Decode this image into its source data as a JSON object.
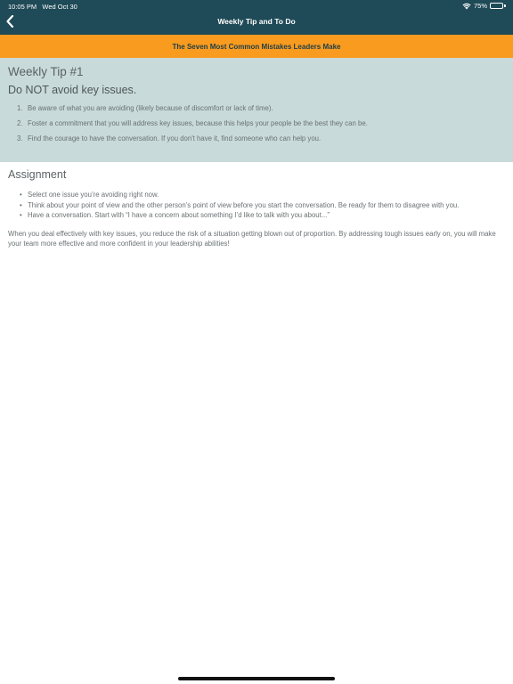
{
  "status_bar": {
    "time": "10:05 PM",
    "date": "Wed Oct 30",
    "battery": "75%",
    "battery_level": 0.75,
    "wifi_icon": "wifi-icon",
    "battery_icon": "battery-icon"
  },
  "nav": {
    "title": "Weekly Tip and To Do",
    "back_icon": "chevron-left-icon"
  },
  "banner": {
    "text": "The Seven Most Common Mistakes Leaders Make"
  },
  "tip": {
    "heading": "Weekly Tip #1",
    "subheading": "Do NOT avoid key issues.",
    "items": [
      {
        "num": "1.",
        "text": "Be aware of what you are avoiding (likely because of discomfort or lack of time)."
      },
      {
        "num": "2.",
        "text": "Foster a commitment that you will address key issues, because this helps your people be the best they can be."
      },
      {
        "num": "3.",
        "text": "Find the courage to have the conversation. If you don't have it, find someone who can help you."
      }
    ]
  },
  "assignment": {
    "heading": "Assignment",
    "bullet": "•",
    "items": [
      "Select one issue you’re avoiding right now.",
      "Think about your point of view and the other person’s point of view before you start the conversation. Be ready for them to disagree with you.",
      "Have a conversation. Start with “I have a concern about something I’d like to talk with you about...”"
    ],
    "closing": "When you deal effectively with key issues, you reduce the risk of a situation getting blown out of proportion. By addressing tough issues early on, you will make your team more effective and more confident in your leadership abilities!"
  },
  "colors": {
    "header_bg": "#1f4a57",
    "banner_bg": "#f99b1f",
    "tip_bg": "#c8dad9"
  }
}
